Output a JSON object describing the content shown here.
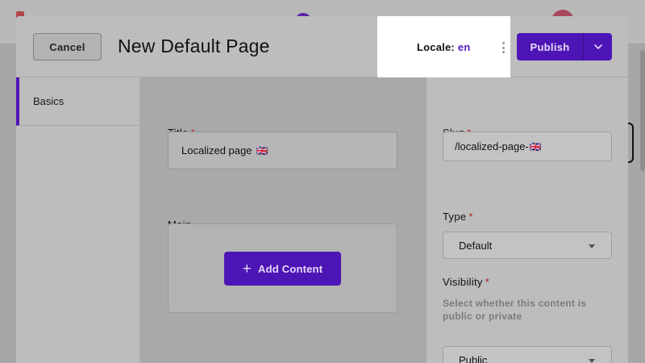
{
  "header": {
    "cancel_label": "Cancel",
    "title": "New Default Page",
    "locale_label": "Locale:",
    "locale_value": "en",
    "publish_label": "Publish"
  },
  "nav": {
    "items": [
      {
        "label": "Basics",
        "active": true
      }
    ]
  },
  "main": {
    "title_label": "Title",
    "title_required": "*",
    "title_value": "Localized page",
    "title_flag": "🇬🇧",
    "main_label": "Main",
    "add_content_label": "Add Content"
  },
  "side": {
    "slug_label": "Slug",
    "slug_required": "*",
    "slug_value": "/localized-page-",
    "slug_flag": "🇬🇧",
    "type_label": "Type",
    "type_required": "*",
    "type_value": "Default",
    "visibility_label": "Visibility",
    "visibility_required": "*",
    "visibility_help": "Select whether this content is public or private",
    "visibility_value": "Public"
  },
  "colors": {
    "accent": "#4d15b5",
    "required": "#b41e1e",
    "overlay": "#a7a7a7"
  }
}
